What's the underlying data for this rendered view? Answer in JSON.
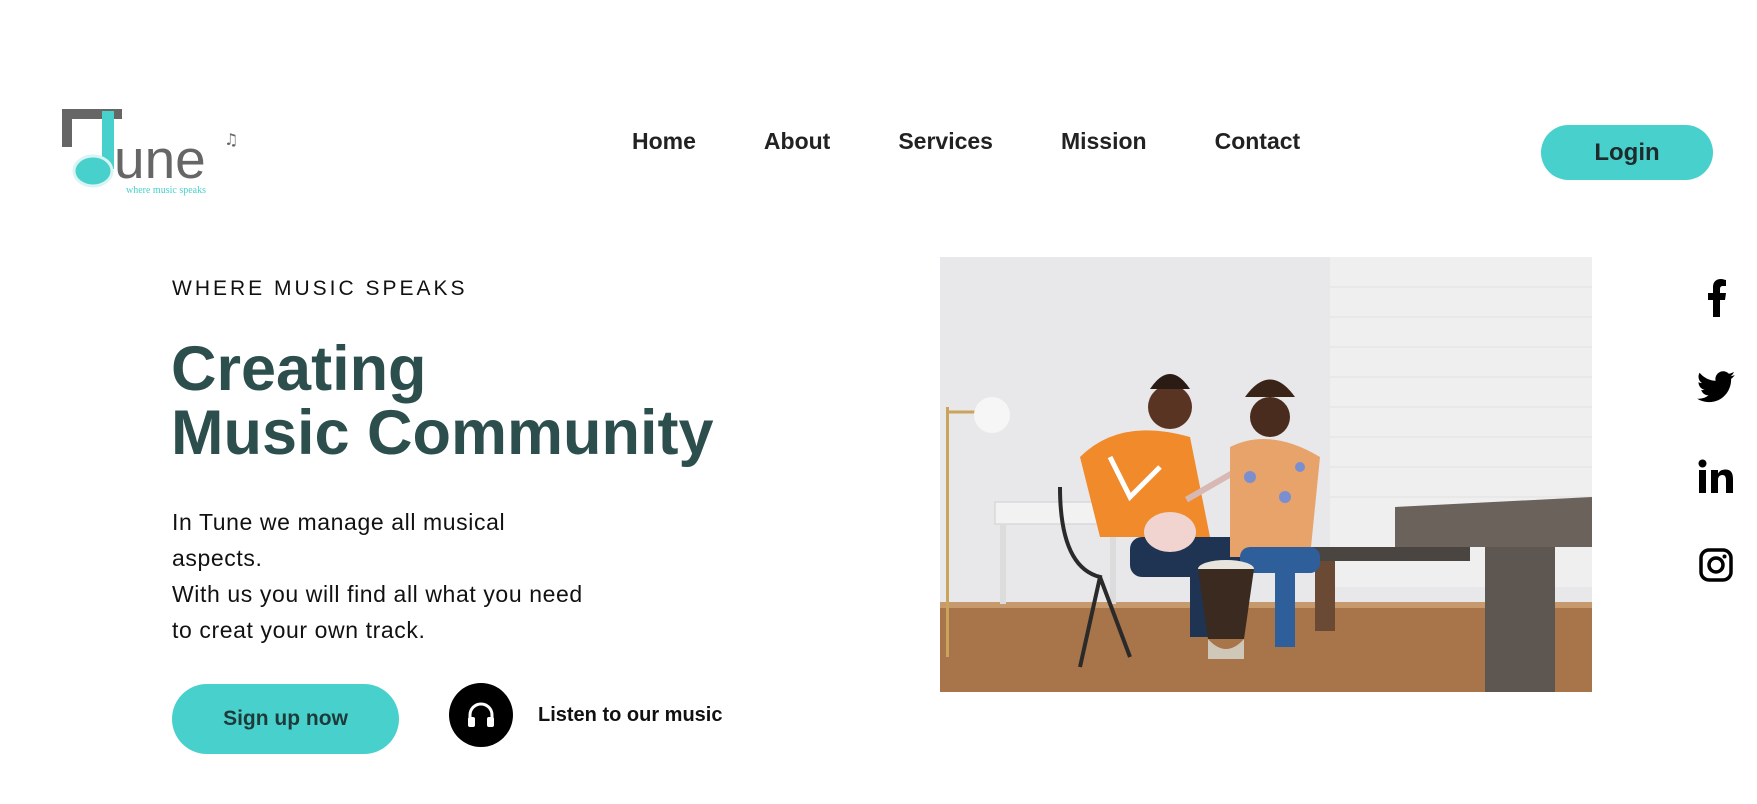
{
  "brand": {
    "name": "une",
    "tagline": "where music speaks",
    "accent_color": "#48d1cc",
    "dark_color": "#666666"
  },
  "nav": {
    "items": [
      {
        "label": "Home"
      },
      {
        "label": "About"
      },
      {
        "label": "Services"
      },
      {
        "label": "Mission"
      },
      {
        "label": "Contact"
      }
    ],
    "login_label": "Login"
  },
  "hero": {
    "eyebrow": "WHERE MUSIC SPEAKS",
    "headline_line1": "Creating",
    "headline_line2": "Music Community",
    "description": [
      "In Tune we manage all musical",
      "aspects.",
      "With us you will find all what you need",
      "to creat your own track."
    ],
    "signup_label": "Sign up now",
    "listen_label": "Listen to our music",
    "listen_icon": "headphones-icon",
    "headline_color": "#2c4f4d"
  },
  "photo": {
    "icon": "musicians-photo"
  },
  "social": [
    {
      "icon": "facebook-icon"
    },
    {
      "icon": "twitter-icon"
    },
    {
      "icon": "linkedin-icon"
    },
    {
      "icon": "instagram-icon"
    }
  ]
}
